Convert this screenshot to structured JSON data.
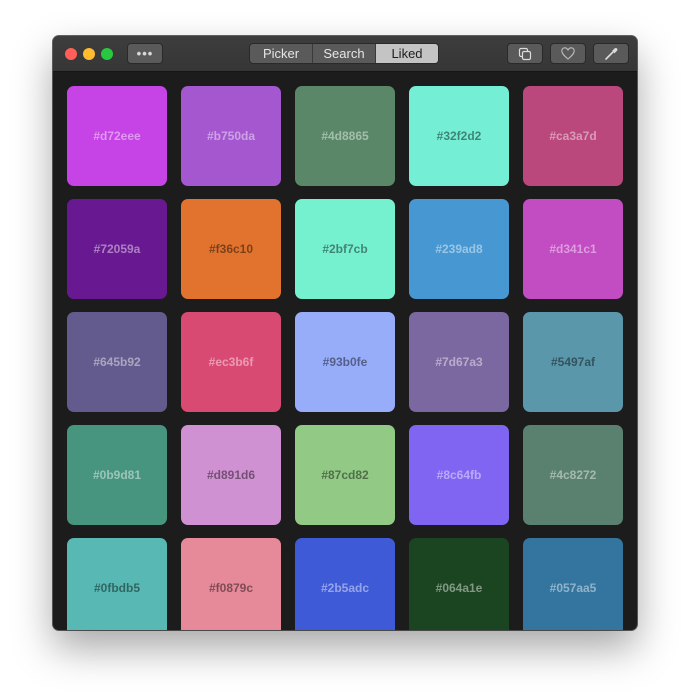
{
  "window": {
    "more_label": "•••",
    "tabs": [
      {
        "label": "Picker",
        "active": false
      },
      {
        "label": "Search",
        "active": false
      },
      {
        "label": "Liked",
        "active": true
      }
    ],
    "toolbar_icons": [
      "copy-icon",
      "heart-icon",
      "eyedropper-icon"
    ]
  },
  "swatches": [
    {
      "hex": "#d72eee",
      "light": false
    },
    {
      "hex": "#b750da",
      "light": false
    },
    {
      "hex": "#4d8865",
      "light": false
    },
    {
      "hex": "#32f2d2",
      "light": true
    },
    {
      "hex": "#ca3a7d",
      "light": false
    },
    {
      "hex": "#72059a",
      "light": false
    },
    {
      "hex": "#f36c10",
      "light": true
    },
    {
      "hex": "#2bf7cb",
      "light": true
    },
    {
      "hex": "#239ad8",
      "light": false
    },
    {
      "hex": "#d341c1",
      "light": false
    },
    {
      "hex": "#645b92",
      "light": false
    },
    {
      "hex": "#ec3b6f",
      "light": false
    },
    {
      "hex": "#93b0fe",
      "light": true
    },
    {
      "hex": "#7d67a3",
      "light": false
    },
    {
      "hex": "#5497af",
      "light": true
    },
    {
      "hex": "#0b9d81",
      "light": false
    },
    {
      "hex": "#d891d6",
      "light": true
    },
    {
      "hex": "#87cd82",
      "light": true
    },
    {
      "hex": "#8c64fb",
      "light": false
    },
    {
      "hex": "#4c8272",
      "light": false
    },
    {
      "hex": "#0fbdb5",
      "light": true
    },
    {
      "hex": "#f0879c",
      "light": true
    },
    {
      "hex": "#2b5adc",
      "light": false
    },
    {
      "hex": "#064a1e",
      "light": false
    },
    {
      "hex": "#057aa5",
      "light": false
    }
  ],
  "swatch_display_colors": [
    "#c643e6",
    "#a557d0",
    "#598767",
    "#74efd6",
    "#bb487c",
    "#681991",
    "#e2732e",
    "#76f1cf",
    "#4797d2",
    "#c24cc2",
    "#635b8e",
    "#d94a72",
    "#98adfa",
    "#7c68a0",
    "#5b97ab",
    "#47957e",
    "#d091d2",
    "#91c985",
    "#8065f2",
    "#5a806f",
    "#58b8b3",
    "#e68999",
    "#3f5ad7",
    "#1b4420",
    "#33759e"
  ]
}
